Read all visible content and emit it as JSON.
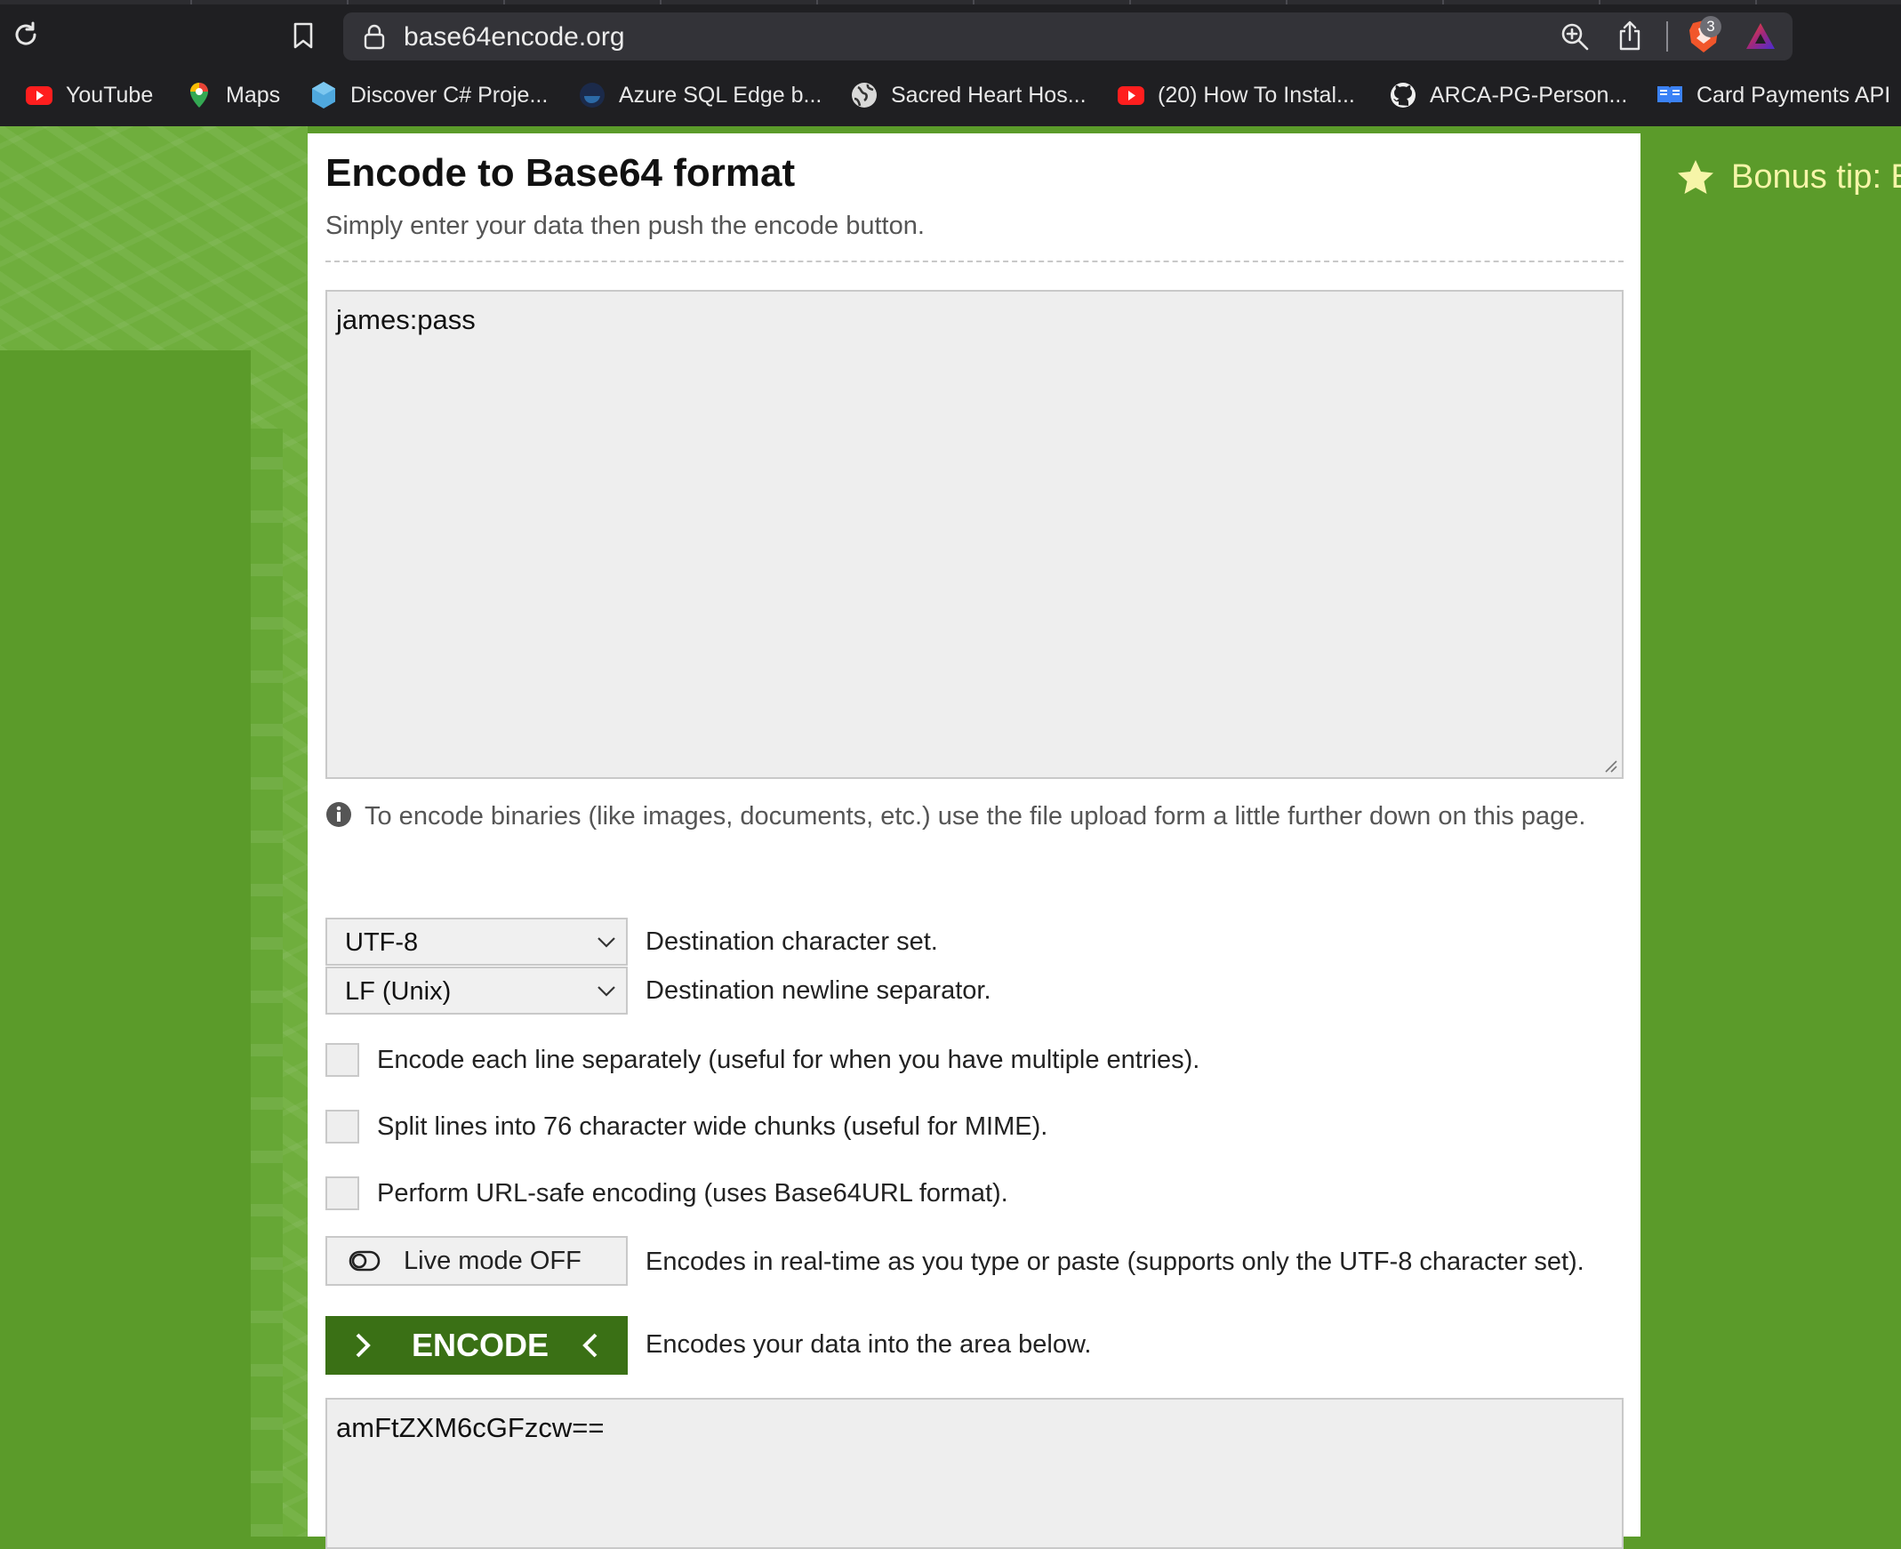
{
  "browser": {
    "url": "base64encode.org",
    "brave_badge_count": "3",
    "bookmarks": [
      {
        "label": "YouTube",
        "icon": "youtube-icon"
      },
      {
        "label": "Maps",
        "icon": "maps-icon"
      },
      {
        "label": "Discover C# Proje...",
        "icon": "hexagon-icon"
      },
      {
        "label": "Azure SQL Edge b...",
        "icon": "docker-icon"
      },
      {
        "label": "Sacred Heart Hos...",
        "icon": "globe-icon"
      },
      {
        "label": "(20) How To Instal...",
        "icon": "youtube-icon"
      },
      {
        "label": "ARCA-PG-Person...",
        "icon": "github-icon"
      },
      {
        "label": "Card Payments API",
        "icon": "book-icon"
      }
    ]
  },
  "sidebar_right": {
    "bonus_tip": "Bonus tip: E"
  },
  "main": {
    "title": "Encode to Base64 format",
    "subtitle": "Simply enter your data then push the encode button.",
    "input_value": "james:pass",
    "info_text": "To encode binaries (like images, documents, etc.) use the file upload form a little further down on this page.",
    "charset": {
      "value": "UTF-8",
      "label": "Destination character set."
    },
    "newline": {
      "value": "LF (Unix)",
      "label": "Destination newline separator."
    },
    "options": [
      {
        "label": "Encode each line separately (useful for when you have multiple entries).",
        "checked": false
      },
      {
        "label": "Split lines into 76 character wide chunks (useful for MIME).",
        "checked": false
      },
      {
        "label": "Perform URL-safe encoding (uses Base64URL format).",
        "checked": false
      }
    ],
    "live_mode": {
      "label": "Live mode OFF",
      "description": "Encodes in real-time as you type or paste (supports only the UTF-8 character set)."
    },
    "encode": {
      "label": "ENCODE",
      "description": "Encodes your data into the area below."
    },
    "output_value": "amFtZXM6cGFzcw=="
  },
  "colors": {
    "page_green": "#5b9b2a",
    "button_green": "#3a7015",
    "tip_yellow": "#f6f5a8"
  }
}
